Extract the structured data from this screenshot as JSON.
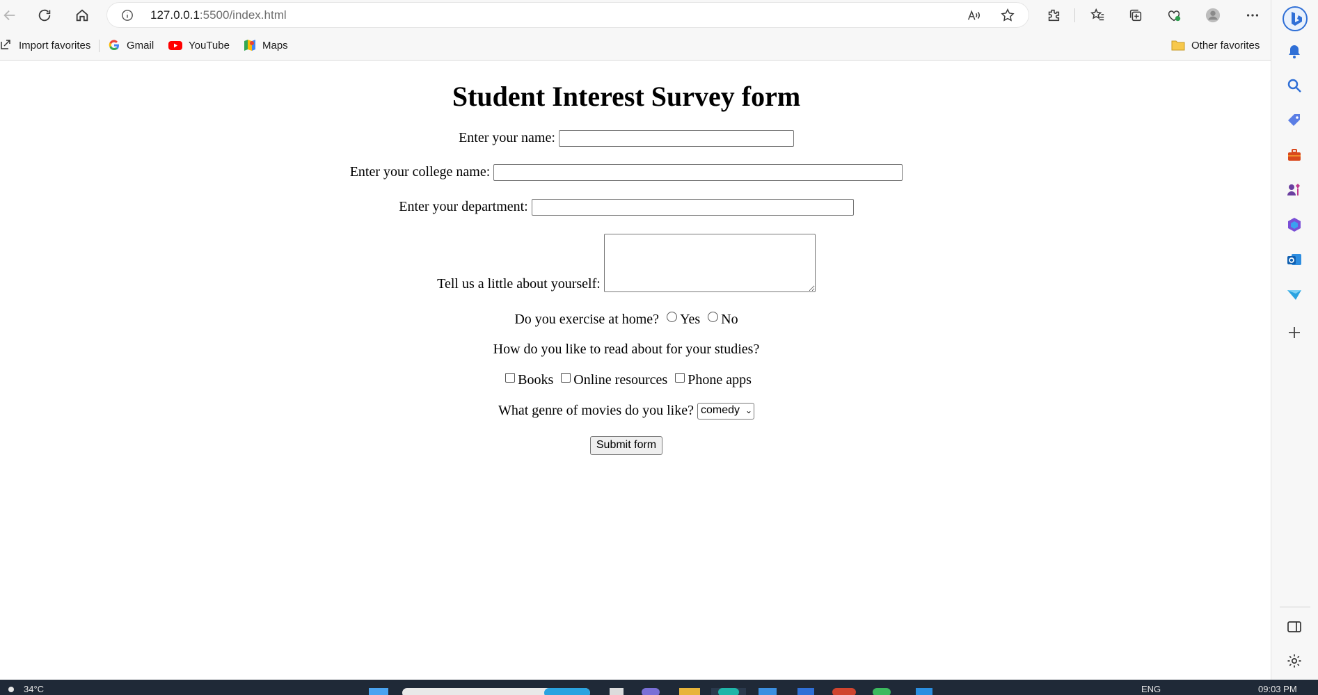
{
  "browser": {
    "url_host": "127.0.0.1",
    "url_rest": ":5500/index.html",
    "favorites": [
      {
        "label": "Import favorites",
        "icon": "import-icon"
      },
      {
        "label": "Gmail",
        "icon": "google-icon"
      },
      {
        "label": "YouTube",
        "icon": "youtube-icon"
      },
      {
        "label": "Maps",
        "icon": "maps-icon"
      }
    ],
    "other_favorites": "Other favorites"
  },
  "form": {
    "title": "Student Interest Survey form",
    "name_label": "Enter your name:",
    "name_value": "",
    "college_label": "Enter your college name:",
    "college_value": "",
    "department_label": "Enter your department:",
    "department_value": "",
    "about_label": "Tell us a little about yourself:",
    "about_value": "",
    "exercise_question": "Do you exercise at home?",
    "exercise_options": [
      "Yes",
      "No"
    ],
    "read_question": "How do you like to read about for your studies?",
    "read_options": [
      "Books",
      "Online resources",
      "Phone apps"
    ],
    "genre_question": "What genre of movies do you like?",
    "genre_selected": "comedy",
    "submit_label": "Submit form"
  },
  "taskbar": {
    "weather": "34°C",
    "language": "ENG",
    "time": "09:03 PM"
  },
  "colors": {
    "chrome_bg": "#f7f7f7",
    "taskbar_bg": "#1f2937",
    "page_bg": "#ffffff"
  }
}
